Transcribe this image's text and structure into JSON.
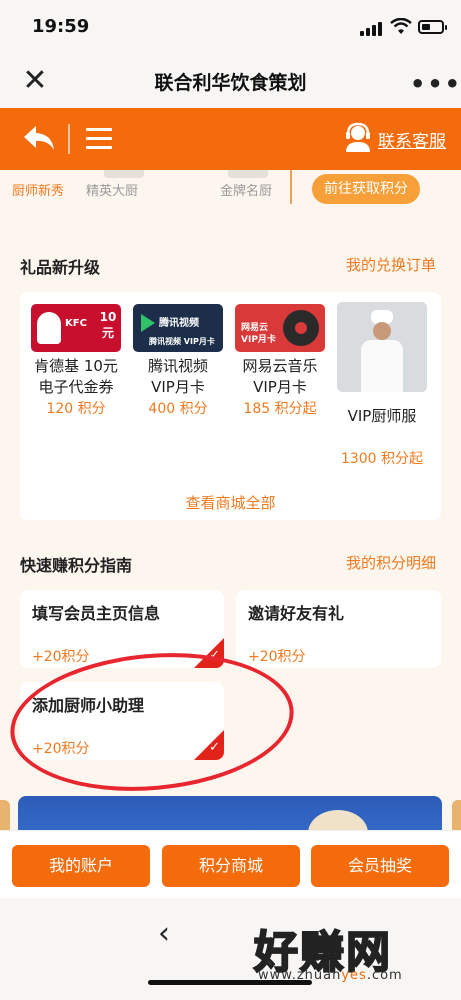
{
  "status": {
    "time": "19:59"
  },
  "titlebar": {
    "title": "联合利华饮食策划",
    "close_glyph": "✕",
    "more_glyph": "•••"
  },
  "header": {
    "service_label": "联系客服"
  },
  "levels": {
    "items": [
      "厨师新秀",
      "精英大厨",
      "金牌名厨"
    ],
    "earn_button": "前往获取积分"
  },
  "gifts": {
    "title": "礼品新升级",
    "link": "我的兑换订单",
    "items": [
      {
        "name_line1": "肯德基 10元",
        "name_line2": "电子代金券",
        "points": "120 积分",
        "img_label": "KFC 10元"
      },
      {
        "name_line1": "腾讯视频",
        "name_line2": "VIP月卡",
        "points": "400 积分",
        "img_label": "腾讯视频 VIP月卡"
      },
      {
        "name_line1": "网易云音乐",
        "name_line2": "VIP月卡",
        "points": "185 积分起",
        "img_label": "网易云 VIP月卡"
      },
      {
        "name_line1": "VIP厨师服",
        "name_line2": "",
        "points": "1300 积分起",
        "img_label": ""
      }
    ],
    "view_all": "查看商城全部"
  },
  "tasks": {
    "title": "快速赚积分指南",
    "link": "我的积分明细",
    "items": [
      {
        "name": "填写会员主页信息",
        "points": "+20积分",
        "done": true
      },
      {
        "name": "邀请好友有礼",
        "points": "+20积分",
        "done": false
      },
      {
        "name": "添加厨师小助理",
        "points": "+20积分",
        "done": true
      }
    ]
  },
  "actions": {
    "account": "我的账户",
    "mall": "积分商城",
    "lottery": "会员抽奖"
  },
  "nav": {
    "back_glyph": "‹"
  },
  "watermark": {
    "main": "好赚网",
    "url_pre": "www.zhuan",
    "url_mid": "yes",
    "url_post": ".com"
  },
  "colors": {
    "accent": "#f36b0b",
    "points": "#f07a20",
    "annotation": "#e8262f"
  }
}
